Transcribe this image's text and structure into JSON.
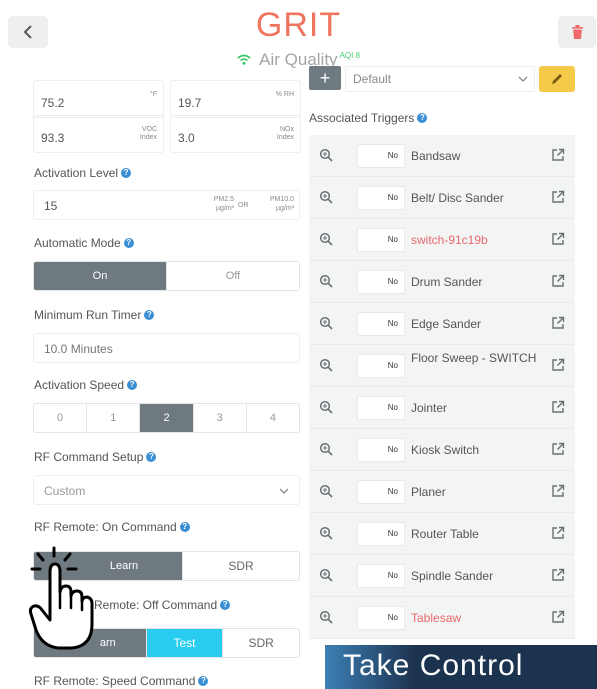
{
  "header": {
    "title": "GRIT",
    "subtitle": "Air Quality",
    "aqi_badge": "AQI 8"
  },
  "sensors": [
    {
      "value": "75.2",
      "unit": "°F"
    },
    {
      "value": "19.7",
      "unit": "% RH"
    },
    {
      "value": "93.3",
      "unit": "VOC Index"
    },
    {
      "value": "3.0",
      "unit": "NOx Index"
    }
  ],
  "activation_level": {
    "label": "Activation Level",
    "value": "15",
    "unit_a": "PM2.5 µg/m³",
    "or": "OR",
    "unit_b": "PM10.0 µg/m³"
  },
  "automatic_mode": {
    "label": "Automatic Mode",
    "options": [
      "On",
      "Off"
    ],
    "selected": "On"
  },
  "min_run_timer": {
    "label": "Minimum Run Timer",
    "value": "10.0 Minutes"
  },
  "activation_speed": {
    "label": "Activation Speed",
    "options": [
      "0",
      "1",
      "2",
      "3",
      "4"
    ],
    "selected": "2"
  },
  "rf_command_setup": {
    "label": "RF Command Setup",
    "value": "Custom"
  },
  "rf_on": {
    "label": "RF Remote: On Command",
    "learn": "Learn",
    "sdr": "SDR"
  },
  "rf_off": {
    "label": "RF Remote: Off Command",
    "visible_label": "Remote: Off Command",
    "learn_partial": "arn",
    "test": "Test",
    "sdr": "SDR"
  },
  "rf_speed": {
    "label": "RF Remote: Speed Command"
  },
  "preset": {
    "value": "Default"
  },
  "triggers": {
    "label": "Associated Triggers",
    "toggle_text": "No",
    "items": [
      {
        "name": "Bandsaw",
        "red": false
      },
      {
        "name": "Belt/ Disc Sander",
        "red": false
      },
      {
        "name": "switch-91c19b",
        "red": true
      },
      {
        "name": "Drum Sander",
        "red": false
      },
      {
        "name": "Edge Sander",
        "red": false
      },
      {
        "name": "Floor Sweep - SWITCH",
        "red": false
      },
      {
        "name": "Jointer",
        "red": false
      },
      {
        "name": "Kiosk Switch",
        "red": false
      },
      {
        "name": "Planer",
        "red": false
      },
      {
        "name": "Router Table",
        "red": false
      },
      {
        "name": "Spindle Sander",
        "red": false
      },
      {
        "name": "Tablesaw",
        "red": true
      }
    ]
  },
  "banner": {
    "text": "Take Control"
  },
  "colors": {
    "title": "#f0755f",
    "selected_segment": "#6f7a80",
    "test_button": "#27ccf0",
    "edit_button": "#f5c94a",
    "link_red": "#e8696d",
    "help_icon": "#3a8fd4"
  }
}
